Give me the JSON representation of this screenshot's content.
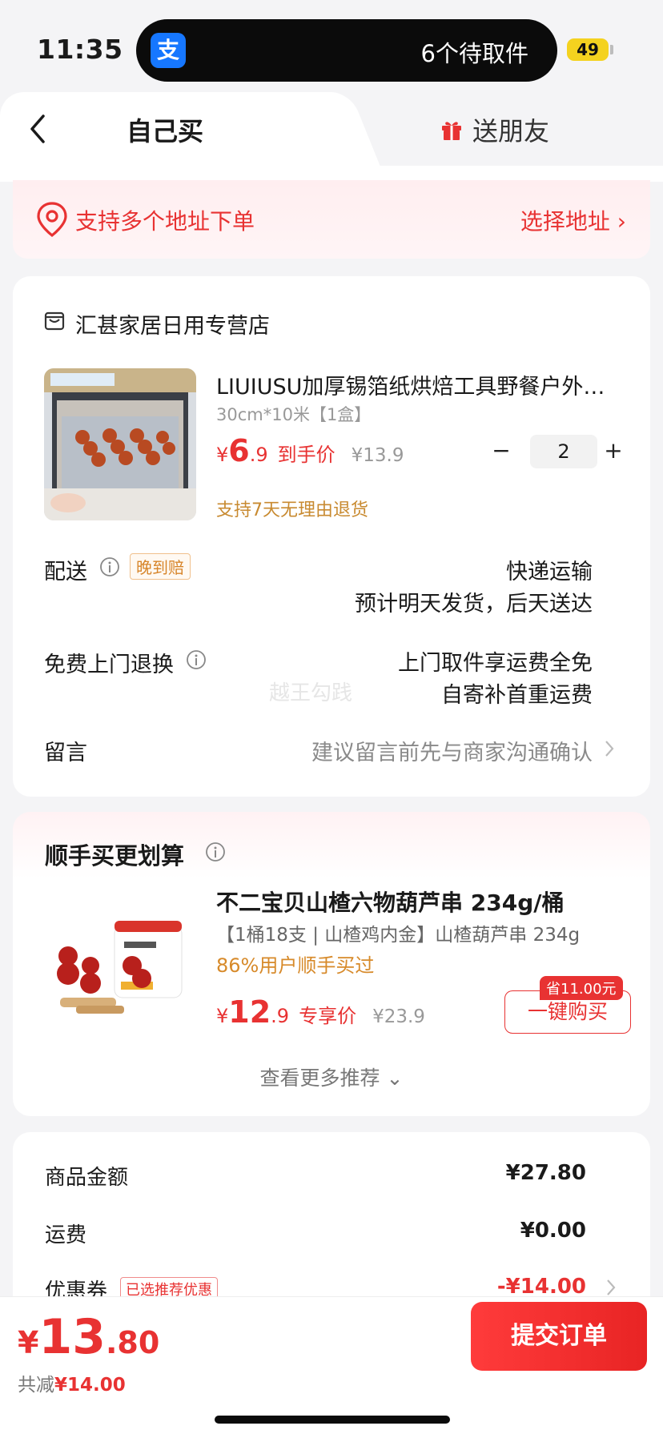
{
  "status_bar": {
    "time": "11:35",
    "island_text": "6个待取件",
    "battery": "49"
  },
  "tabs": {
    "self": "自己买",
    "gift": "送朋友"
  },
  "address": {
    "text": "支持多个地址下单",
    "select": "选择地址 ›"
  },
  "store": {
    "name": "汇甚家居日用专营店"
  },
  "product": {
    "title": "LIUIUSU加厚锡箔纸烘焙工具野餐户外…",
    "spec": "30cm*10米【1盒】",
    "price_yen": "¥",
    "price_int": "6",
    "price_dec": ".9",
    "price_label": "到手价",
    "orig_price": "¥13.9",
    "qty": "2",
    "minus": "−",
    "plus": "+",
    "return_policy": "支持7天无理由退货"
  },
  "delivery": {
    "label": "配送",
    "badge": "晚到赔",
    "method": "快递运输",
    "eta": "预计明天发货，后天送达"
  },
  "free_return": {
    "label": "免费上门退换",
    "line1": "上门取件享运费全免",
    "line2": "自寄补首重运费"
  },
  "watermark": "越王勾践",
  "message": {
    "label": "留言",
    "hint": "建议留言前先与商家沟通确认"
  },
  "recommend": {
    "title": "顺手买更划算",
    "name": "不二宝贝山楂六物葫芦串 234g/桶",
    "spec": "【1桶18支 | 山楂鸡内金】山楂葫芦串 234g",
    "bought": "86%用户顺手买过",
    "price_yen": "¥",
    "price_int": "12",
    "price_dec": ".9",
    "price_label": "专享价",
    "orig_price": "¥23.9",
    "save_badge": "省11.00元",
    "buy_button": "一键购买",
    "more": "查看更多推荐 ⌄"
  },
  "summary": {
    "goods_label": "商品金额",
    "goods_value": "¥27.80",
    "freight_label": "运费",
    "freight_value": "¥0.00",
    "coupon_label": "优惠券",
    "coupon_badge": "已选推荐优惠",
    "coupon_value": "-¥14.00"
  },
  "bottom": {
    "yen": "¥",
    "total_int": "13",
    "total_dec": ".80",
    "reduce_prefix": "共减",
    "reduce_value": "¥14.00",
    "submit": "提交订单"
  },
  "colors": {
    "accent_red": "#e83232",
    "alipay_blue": "#1677ff",
    "gold": "#c88a30"
  }
}
